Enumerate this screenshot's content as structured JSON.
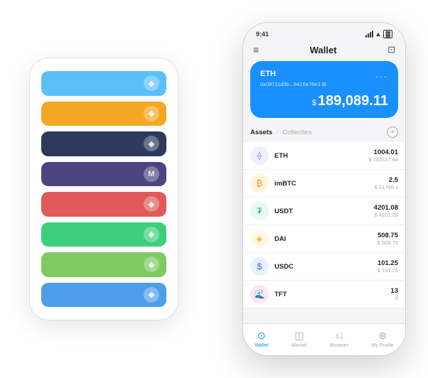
{
  "scene": {
    "back_phone": {
      "cards": [
        {
          "color": "#5bc0f8",
          "icon": "◆"
        },
        {
          "color": "#f5a623",
          "icon": "◆"
        },
        {
          "color": "#2d3a5e",
          "icon": "◆"
        },
        {
          "color": "#4a4580",
          "icon": "M"
        },
        {
          "color": "#e05a5a",
          "icon": "◆"
        },
        {
          "color": "#3ecf7c",
          "icon": "◆"
        },
        {
          "color": "#7ecb5f",
          "icon": "◆"
        },
        {
          "color": "#4d9ee8",
          "icon": "◆"
        }
      ]
    },
    "front_phone": {
      "status_bar": {
        "time": "9:41",
        "signal": "●●●",
        "wifi": "wifi",
        "battery": "battery"
      },
      "header": {
        "menu_icon": "≡",
        "title": "Wallet",
        "scan_icon": "⊡"
      },
      "wallet_card": {
        "label": "ETH",
        "dots": "...",
        "address": "0x08711d3b...8416a78e3 ⊞",
        "balance_symbol": "$",
        "balance": "189,089.11"
      },
      "assets_header": {
        "tab_active": "Assets",
        "divider": "/",
        "tab_inactive": "Collecties",
        "add_label": "+"
      },
      "assets": [
        {
          "name": "ETH",
          "icon": "⟠",
          "icon_color": "#627eea",
          "icon_bg": "#eef0fd",
          "amount": "1004.01",
          "value": "$ 162517.48"
        },
        {
          "name": "imBTC",
          "icon": "₿",
          "icon_color": "#f7931a",
          "icon_bg": "#fff3e0",
          "amount": "2.5",
          "value": "$ 21760.1"
        },
        {
          "name": "USDT",
          "icon": "₮",
          "icon_color": "#26a17b",
          "icon_bg": "#e8f8f4",
          "amount": "4201.08",
          "value": "$ 4201.08"
        },
        {
          "name": "DAI",
          "icon": "◈",
          "icon_color": "#f5ac37",
          "icon_bg": "#fff8e8",
          "amount": "508.75",
          "value": "$ 508.75"
        },
        {
          "name": "USDC",
          "icon": "$",
          "icon_color": "#2775ca",
          "icon_bg": "#e8f0fb",
          "amount": "101.25",
          "value": "$ 101.25"
        },
        {
          "name": "TFT",
          "icon": "🌊",
          "icon_color": "#e84393",
          "icon_bg": "#fde8f2",
          "amount": "13",
          "value": "0"
        }
      ],
      "nav": [
        {
          "label": "Wallet",
          "icon": "⊙",
          "active": true
        },
        {
          "label": "Market",
          "icon": "📊",
          "active": false
        },
        {
          "label": "Browser",
          "icon": "👤",
          "active": false
        },
        {
          "label": "My Profile",
          "icon": "👤",
          "active": false
        }
      ]
    }
  }
}
